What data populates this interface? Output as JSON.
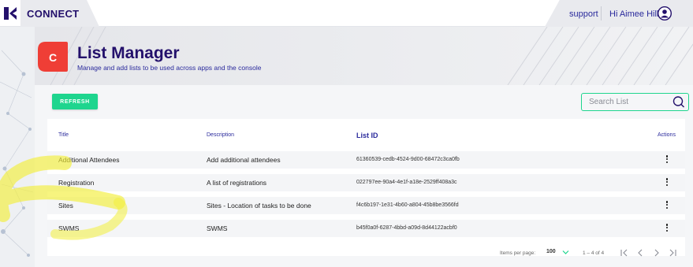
{
  "topbar": {
    "brand": "CONNECT",
    "support_label": "support",
    "greeting": "Hi Aimee Hills!"
  },
  "header": {
    "app_letter": "C",
    "title": "List Manager",
    "subtitle": "Manage and add lists to be used across apps and the console"
  },
  "toolbar": {
    "refresh_label": "REFRESH",
    "search_placeholder": "Search List",
    "search_value": ""
  },
  "table": {
    "columns": {
      "title": "Title",
      "description": "Description",
      "list_id": "List ID",
      "actions": "Actions"
    },
    "rows": [
      {
        "title": "Additional Attendees",
        "description": "Add additional attendees",
        "list_id": "61360539-cedb-4524-9d00-68472c3ca0fb"
      },
      {
        "title": "Registration",
        "description": "A list of registrations",
        "list_id": "022797ee-90a4-4e1f-a18e-2529ff408a3c"
      },
      {
        "title": "Sites",
        "description": "Sites - Location of tasks to be done",
        "list_id": "f4c6b197-1e31-4b60-a804-45b8be3566fd"
      },
      {
        "title": "SWMS",
        "description": "SWMS",
        "list_id": "b45f0a0f-6287-4bbd-a09d-8d44122acbf0"
      }
    ]
  },
  "pagination": {
    "items_per_page_label": "Items per page:",
    "items_per_page_value": "100",
    "range_label": "1 – 4 of 4"
  },
  "colors": {
    "brand_navy": "#23106b",
    "link_blue": "#2a2a9c",
    "accent_green": "#1ed58e",
    "app_red": "#ef3e36",
    "annotation_yellow": "#f2ee3a"
  },
  "icons": [
    "k-logo-icon",
    "user-avatar-icon",
    "app-c-icon",
    "search-icon",
    "more-vert-icon",
    "chevron-down-icon",
    "first-page-icon",
    "prev-page-icon",
    "next-page-icon",
    "last-page-icon"
  ]
}
